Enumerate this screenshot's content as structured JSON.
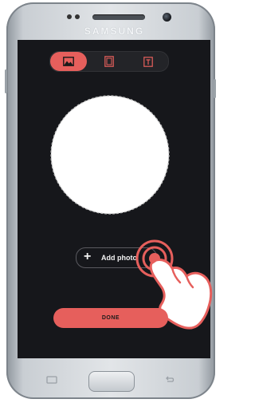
{
  "device": {
    "brand": "SAMSUNG"
  },
  "toolbar": {
    "tabs": [
      {
        "name": "image",
        "icon": "image-icon",
        "active": true
      },
      {
        "name": "frame",
        "icon": "frame-icon",
        "active": false
      },
      {
        "name": "text",
        "icon": "text-icon",
        "active": false
      }
    ]
  },
  "main": {
    "add_photo_label": "Add photo",
    "done_label": "DONE"
  },
  "colors": {
    "accent": "#e65f5c",
    "screen_background": "#16171b"
  }
}
